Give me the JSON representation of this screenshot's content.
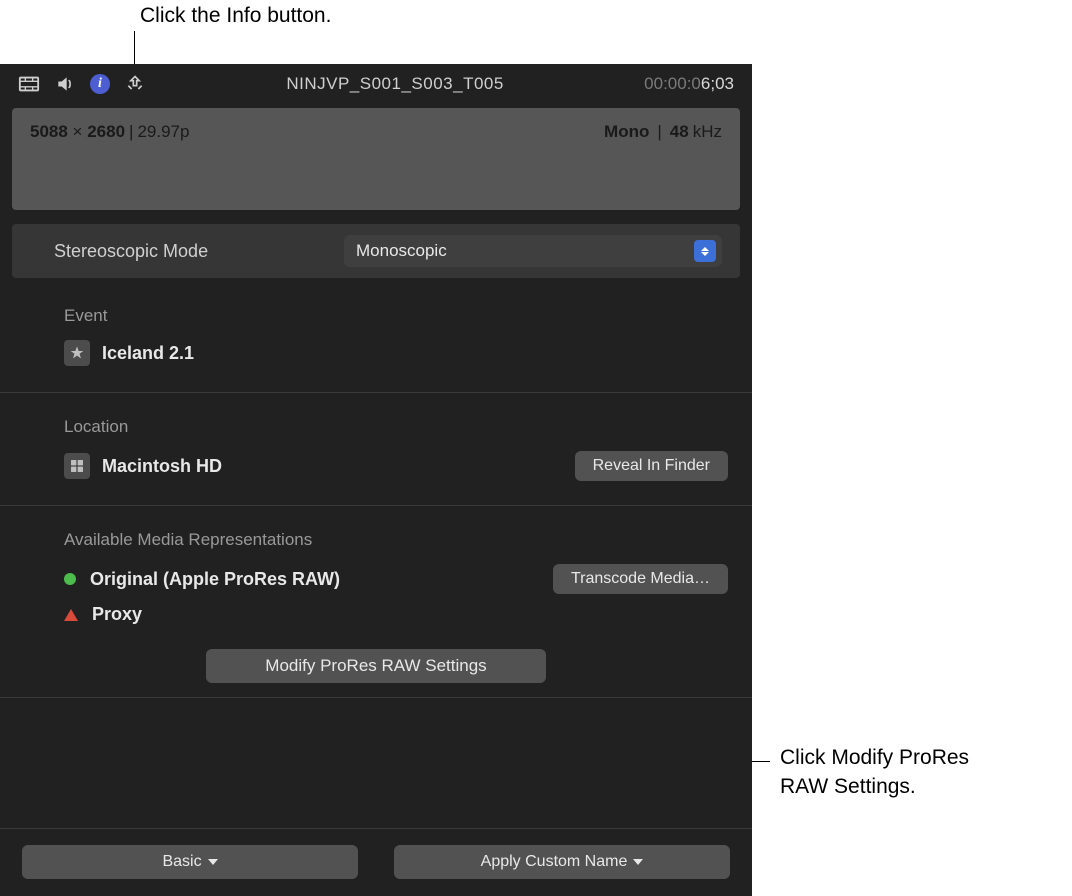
{
  "callouts": {
    "top": "Click the Info button.",
    "right": "Click Modify ProRes\nRAW Settings."
  },
  "toolbar": {
    "clip_title": "NINJVP_S001_S003_T005",
    "timecode_dim": "00:00:0",
    "timecode_bright": "6;03"
  },
  "format": {
    "width": "5088",
    "height": "2680",
    "rate": "29.97p",
    "audio_channels": "Mono",
    "audio_freq": "48",
    "audio_unit": "kHz"
  },
  "stereo": {
    "label": "Stereoscopic Mode",
    "value": "Monoscopic"
  },
  "event": {
    "label": "Event",
    "name": "Iceland 2.1"
  },
  "location": {
    "label": "Location",
    "name": "Macintosh HD",
    "reveal_button": "Reveal In Finder"
  },
  "media": {
    "label": "Available Media Representations",
    "original": "Original (Apple ProRes RAW)",
    "proxy": "Proxy",
    "transcode_button": "Transcode Media…",
    "modify_button": "Modify ProRes RAW Settings"
  },
  "footer": {
    "basic": "Basic",
    "apply": "Apply Custom Name"
  }
}
